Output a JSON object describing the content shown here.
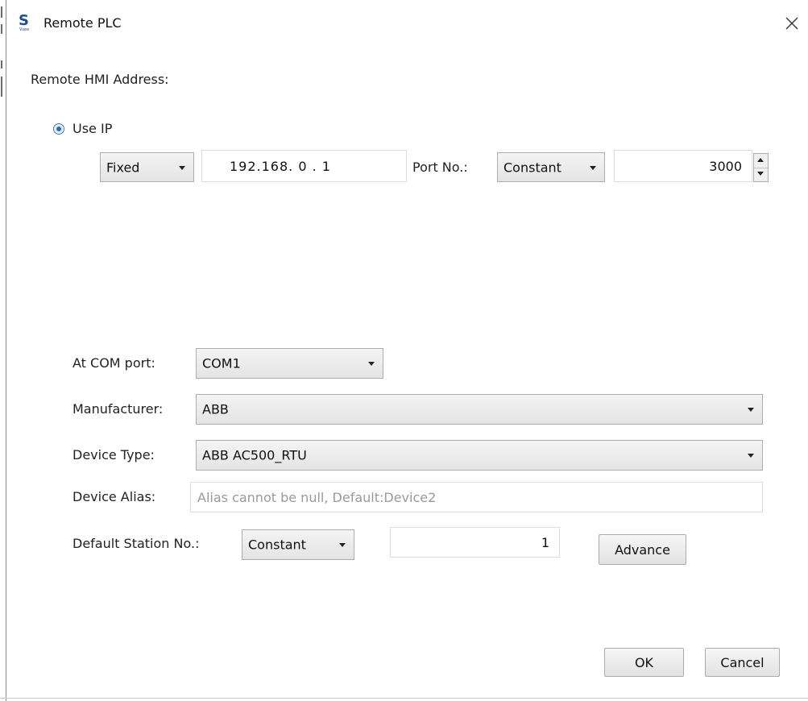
{
  "window": {
    "title": "Remote PLC",
    "logo_letter": "S",
    "logo_sub": "Vsee"
  },
  "remote_hmi": {
    "heading": "Remote HMI Address:",
    "use_ip_label": "Use IP",
    "use_ip_selected": true,
    "ip_mode": "Fixed",
    "ip_address": "192.168. 0 . 1",
    "port_label": "Port No.:",
    "port_mode": "Constant",
    "port_value": "3000"
  },
  "device": {
    "com_port_label": "At COM port:",
    "com_port": "COM1",
    "manufacturer_label": "Manufacturer:",
    "manufacturer": "ABB",
    "device_type_label": "Device Type:",
    "device_type": "ABB AC500_RTU",
    "device_alias_label": "Device Alias:",
    "device_alias_value": "",
    "device_alias_placeholder": "Alias cannot be null, Default:Device2",
    "station_label": "Default Station No.:",
    "station_mode": "Constant",
    "station_value": "1",
    "advance_label": "Advance"
  },
  "actions": {
    "ok_label": "OK",
    "cancel_label": "Cancel"
  },
  "colors": {
    "logo": "#1a4f8f",
    "radio_fill": "#2d6bb0",
    "placeholder": "#9a9a9a"
  },
  "icons": [
    "app-logo-icon",
    "close-icon",
    "dropdown-arrow-icon",
    "spin-up-icon",
    "spin-down-icon"
  ]
}
